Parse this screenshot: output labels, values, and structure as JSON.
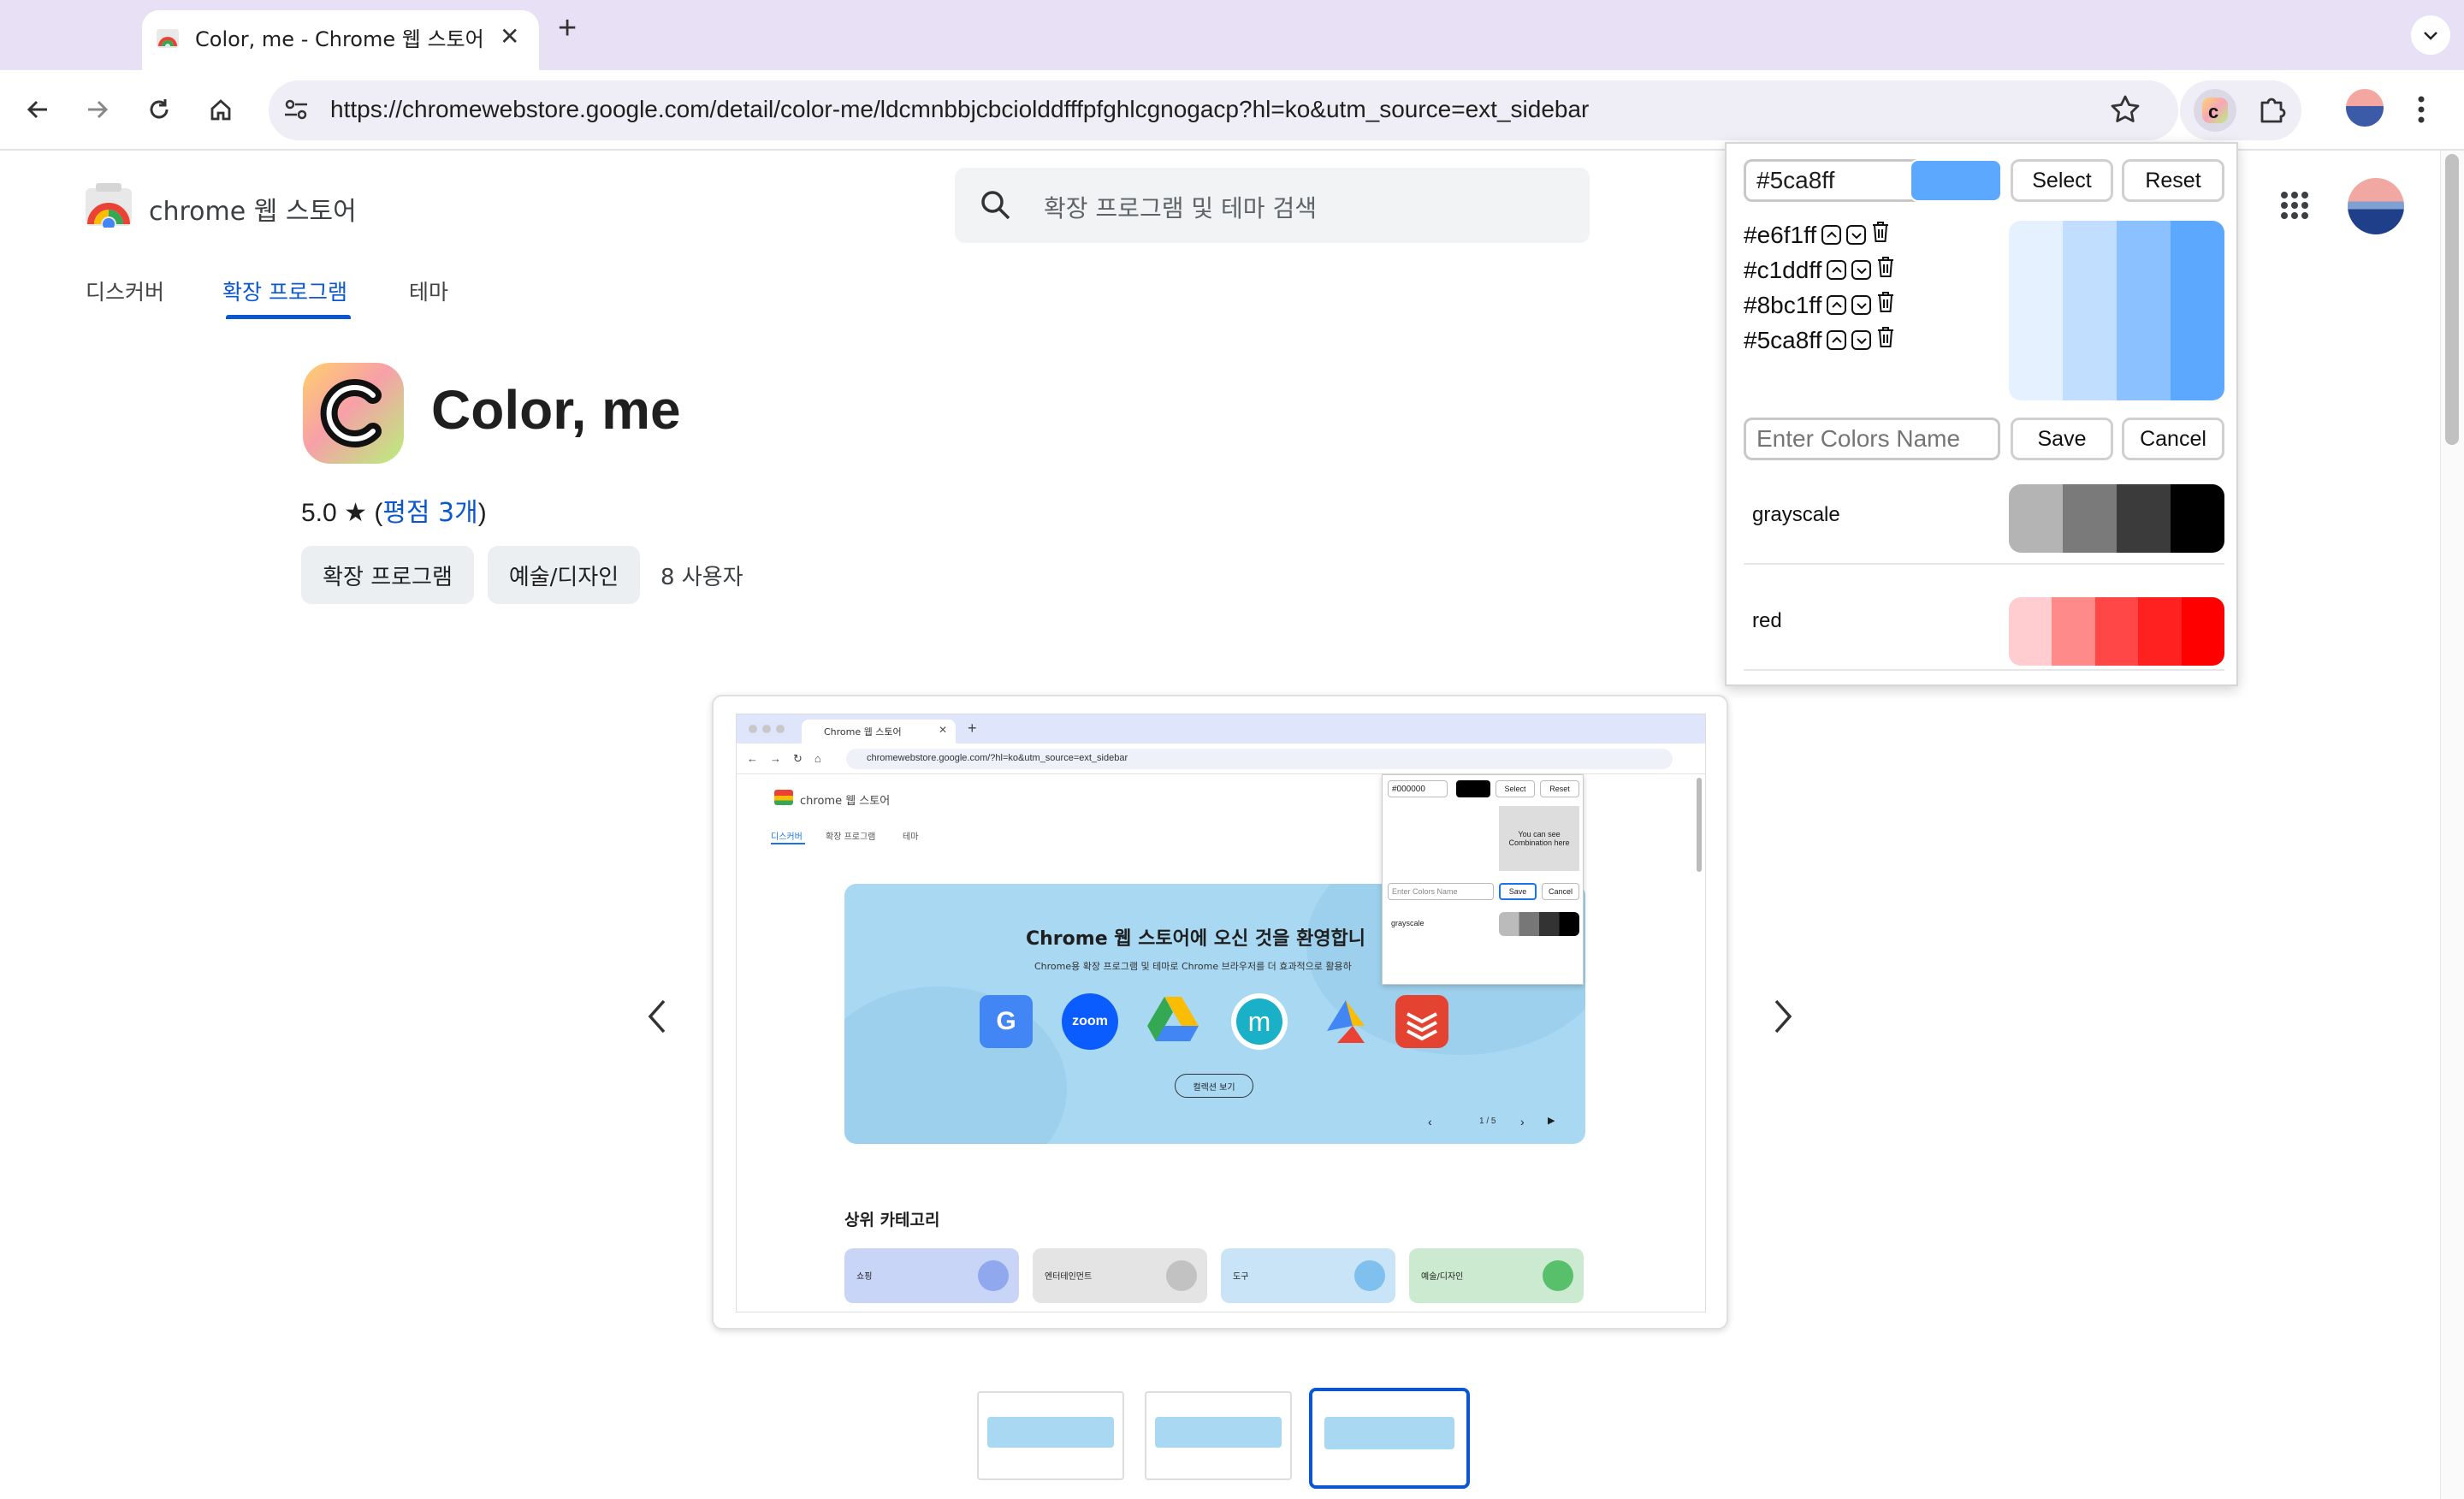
{
  "browser": {
    "tab_title": "Color, me - Chrome 웹 스토어",
    "url_display": "https://chromewebstore.google.com/detail/color-me/ldcmnbbjcbcioldd​fffpfghlcgnogacp?hl=ko&utm_source=ext_sidebar"
  },
  "store": {
    "logo_text": "chrome 웹 스토어",
    "search_placeholder": "확장 프로그램 및 테마 검색",
    "nav": [
      "디스커버",
      "확장 프로그램",
      "테마"
    ],
    "active_nav_index": 1
  },
  "extension": {
    "name": "Color, me",
    "rating": "5.0",
    "star": "★",
    "ratings_prefix": "(",
    "ratings_link": "평점 3개",
    "ratings_suffix": ")",
    "chips": [
      "확장 프로그램",
      "예술/디자인"
    ],
    "users": "8 사용자"
  },
  "carousel": {
    "prev": "‹",
    "next": "›",
    "active_thumb_index": 2
  },
  "screenshot": {
    "tab_title": "Chrome 웹 스토어",
    "url": "chromewebstore.google.com/?hl=ko&utm_source=ext_sidebar",
    "logo_text": "chrome 웹 스토어",
    "nav": [
      "디스커버",
      "확장 프로그램",
      "테마"
    ],
    "hero_title": "Chrome 웹 스토어에 오신 것을 환영합니",
    "hero_sub": "Chrome용 확장 프로그램 및 테마로 Chrome 브라우저를 더 효과적으로 활용하",
    "hero_button": "컬렉션 보기",
    "pager": "1 / 5",
    "app_zoom": "zoom",
    "app_m": "m",
    "section_title": "상위 카테고리",
    "categories": [
      "쇼핑",
      "엔터테인먼트",
      "도구",
      "예술/디자인"
    ],
    "popup": {
      "hex": "#000000",
      "select": "Select",
      "reset": "Reset",
      "hint": "You can see Combination here",
      "name_placeholder": "Enter Colors Name",
      "save": "Save",
      "cancel": "Cancel",
      "palette": "grayscale"
    }
  },
  "popup": {
    "hex_value": "#5ca8ff",
    "picker_color": "#5ca8ff",
    "select_label": "Select",
    "reset_label": "Reset",
    "colors": [
      "#e6f1ff",
      "#c1ddff",
      "#8bc1ff",
      "#5ca8ff"
    ],
    "name_placeholder": "Enter Colors Name",
    "save_label": "Save",
    "cancel_label": "Cancel",
    "palettes": [
      {
        "name": "grayscale",
        "swatches": [
          "#b4b4b4",
          "#7a7a7a",
          "#3b3b3b",
          "#000000"
        ]
      },
      {
        "name": "red",
        "swatches": [
          "#ffccd0",
          "#ff8a8a",
          "#ff4747",
          "#ff2020",
          "#ff0000"
        ]
      }
    ]
  }
}
